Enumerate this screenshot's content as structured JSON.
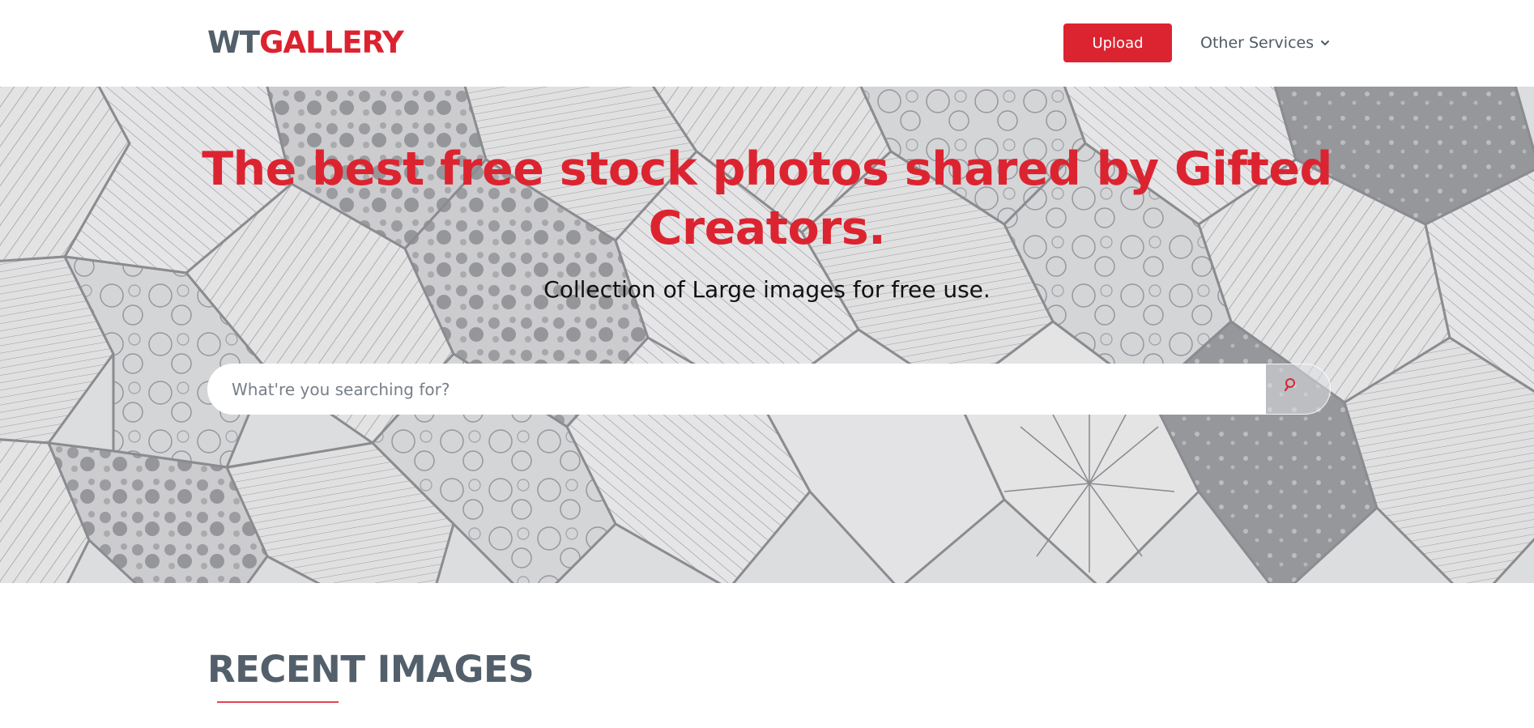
{
  "logo": {
    "part1": "WT",
    "part2": "GALLERY"
  },
  "nav": {
    "upload_label": "Upload",
    "services_label": "Other Services",
    "services_icon": "chevron-down-icon"
  },
  "hero": {
    "title_line1": "The best free stock photos shared by Gifted",
    "title_line2": "Creators.",
    "subtitle": "Collection of Large images for free use.",
    "background": "hexagon-tile-pattern"
  },
  "search": {
    "placeholder": "What're you searching for?",
    "value": "",
    "icon": "search-icon"
  },
  "recent": {
    "heading": "RECENT IMAGES"
  },
  "colors": {
    "brand_red": "#dc2430",
    "brand_gray": "#535f6b",
    "underline": "#e0454f"
  }
}
